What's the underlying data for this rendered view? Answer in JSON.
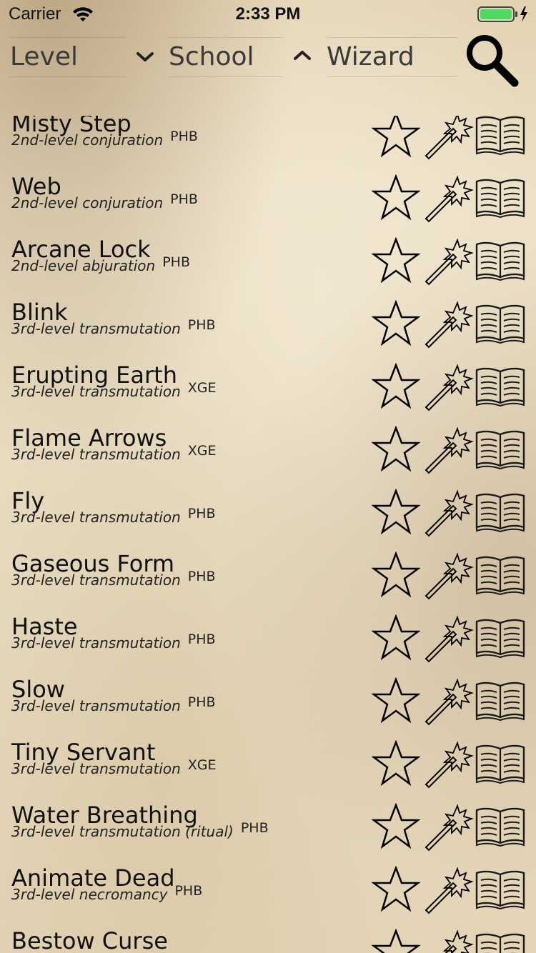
{
  "status_bar": {
    "carrier": "Carrier",
    "time": "2:33 PM",
    "battery_color": "#4cd964",
    "icons": [
      "wifi-icon",
      "battery-icon",
      "charging-icon"
    ]
  },
  "filters": {
    "level_label": "Level",
    "school_label": "School",
    "class_label": "Wizard",
    "level_sort_icon": "chevron-down-icon",
    "school_sort_icon": "chevron-up-icon",
    "search_icon": "search-icon"
  },
  "spells": [
    {
      "name": "Misty Step",
      "desc": "2nd-level conjuration",
      "source": "PHB"
    },
    {
      "name": "Web",
      "desc": "2nd-level conjuration",
      "source": "PHB"
    },
    {
      "name": "Arcane Lock",
      "desc": "2nd-level abjuration",
      "source": "PHB"
    },
    {
      "name": "Blink",
      "desc": "3rd-level transmutation",
      "source": "PHB"
    },
    {
      "name": "Erupting Earth",
      "desc": "3rd-level transmutation",
      "source": "XGE"
    },
    {
      "name": "Flame Arrows",
      "desc": "3rd-level transmutation",
      "source": "XGE"
    },
    {
      "name": "Fly",
      "desc": "3rd-level transmutation",
      "source": "PHB"
    },
    {
      "name": "Gaseous Form",
      "desc": "3rd-level transmutation",
      "source": "PHB"
    },
    {
      "name": "Haste",
      "desc": "3rd-level transmutation",
      "source": "PHB"
    },
    {
      "name": "Slow",
      "desc": "3rd-level transmutation",
      "source": "PHB"
    },
    {
      "name": "Tiny Servant",
      "desc": "3rd-level transmutation",
      "source": "XGE"
    },
    {
      "name": "Water Breathing",
      "desc": "3rd-level transmutation (ritual)",
      "source": "PHB"
    },
    {
      "name": "Animate Dead",
      "desc": "3rd-level necromancy",
      "source": "PHB"
    },
    {
      "name": "Bestow Curse",
      "desc": "",
      "source": ""
    }
  ],
  "row_icons": [
    "star-icon",
    "magic-wand-icon",
    "open-book-icon"
  ]
}
